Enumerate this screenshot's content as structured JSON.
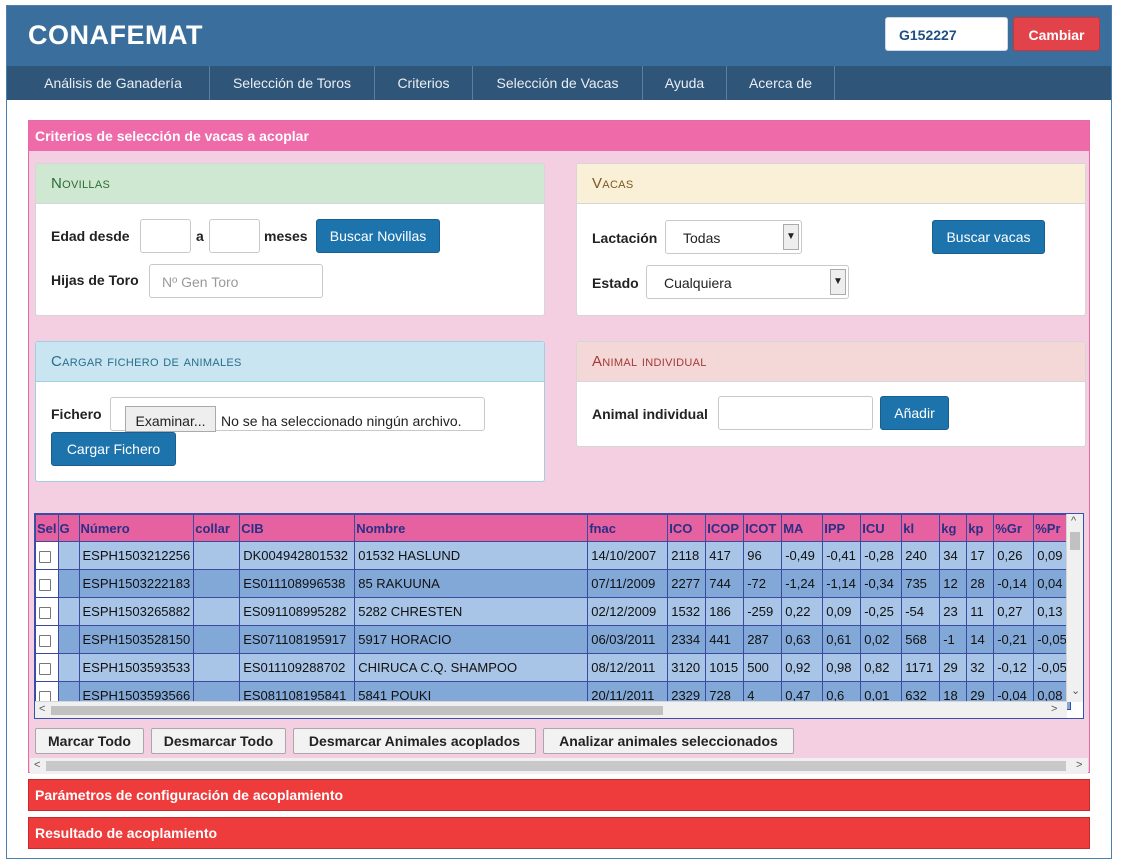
{
  "app": {
    "title": "CONAFEMAT",
    "user_code": "G152227",
    "change_label": "Cambiar"
  },
  "nav": [
    {
      "label": "Análisis de Ganadería"
    },
    {
      "label": "Selección de Toros"
    },
    {
      "label": "Criterios"
    },
    {
      "label": "Selección de Vacas"
    },
    {
      "label": "Ayuda"
    },
    {
      "label": "Acerca de"
    }
  ],
  "criteria_panel": {
    "title": "Criterios de selección de vacas a acoplar"
  },
  "novillas": {
    "title": "Novillas",
    "age_from_label": "Edad desde",
    "age_from_value": "",
    "to_label": "a",
    "age_to_value": "",
    "months_label": "meses",
    "search_button": "Buscar Novillas",
    "daughters_label": "Hijas de Toro",
    "bull_placeholder": "Nº Gen Toro"
  },
  "vacas": {
    "title": "Vacas",
    "lactation_label": "Lactación",
    "lactation_value": "Todas",
    "state_label": "Estado",
    "state_value": "Cualquiera",
    "search_button": "Buscar vacas"
  },
  "file_upload": {
    "title": "Cargar fichero de animales",
    "file_label": "Fichero",
    "browse_button": "Examinar...",
    "no_file_text": "No se ha seleccionado ningún archivo.",
    "upload_button": "Cargar Fichero"
  },
  "individual": {
    "title": "Animal individual",
    "field_label": "Animal individual",
    "field_value": "",
    "add_button": "Añadir"
  },
  "animals_table": {
    "columns": [
      "Sel",
      "G",
      "Número",
      "collar",
      "CIB",
      "Nombre",
      "fnac",
      "ICO",
      "ICOP",
      "ICOT",
      "MA",
      "IPP",
      "ICU",
      "kl",
      "kg",
      "kp",
      "%Gr",
      "%Pr"
    ],
    "rows": [
      {
        "numero": "ESPH1503212256",
        "collar": "",
        "cib": "DK004942801532",
        "nombre": "01532 HASLUND",
        "fnac": "14/10/2007",
        "ico": "2118",
        "icop": "417",
        "icot": "96",
        "ma": "-0,49",
        "ipp": "-0,41",
        "icu": "-0,28",
        "kl": "240",
        "kg": "34",
        "kp": "17",
        "gr": "0,26",
        "pr": "0,09"
      },
      {
        "numero": "ESPH1503222183",
        "collar": "",
        "cib": "ES011108996538",
        "nombre": "85 RAKUUNA",
        "fnac": "07/11/2009",
        "ico": "2277",
        "icop": "744",
        "icot": "-72",
        "ma": "-1,24",
        "ipp": "-1,14",
        "icu": "-0,34",
        "kl": "735",
        "kg": "12",
        "kp": "28",
        "gr": "-0,14",
        "pr": "0,04"
      },
      {
        "numero": "ESPH1503265882",
        "collar": "",
        "cib": "ES091108995282",
        "nombre": "5282 CHRESTEN",
        "fnac": "02/12/2009",
        "ico": "1532",
        "icop": "186",
        "icot": "-259",
        "ma": "0,22",
        "ipp": "0,09",
        "icu": "-0,25",
        "kl": "-54",
        "kg": "23",
        "kp": "11",
        "gr": "0,27",
        "pr": "0,13"
      },
      {
        "numero": "ESPH1503528150",
        "collar": "",
        "cib": "ES071108195917",
        "nombre": "5917 HORACIO",
        "fnac": "06/03/2011",
        "ico": "2334",
        "icop": "441",
        "icot": "287",
        "ma": "0,63",
        "ipp": "0,61",
        "icu": "0,02",
        "kl": "568",
        "kg": "-1",
        "kp": "14",
        "gr": "-0,21",
        "pr": "-0,05"
      },
      {
        "numero": "ESPH1503593533",
        "collar": "",
        "cib": "ES011109288702",
        "nombre": "CHIRUCA C.Q. SHAMPOO",
        "fnac": "08/12/2011",
        "ico": "3120",
        "icop": "1015",
        "icot": "500",
        "ma": "0,92",
        "ipp": "0,98",
        "icu": "0,82",
        "kl": "1171",
        "kg": "29",
        "kp": "32",
        "gr": "-0,12",
        "pr": "-0,05"
      },
      {
        "numero": "ESPH1503593566",
        "collar": "",
        "cib": "ES081108195841",
        "nombre": "5841 POUKI",
        "fnac": "20/11/2011",
        "ico": "2329",
        "icop": "728",
        "icot": "4",
        "ma": "0,47",
        "ipp": "0,6",
        "icu": "0,01",
        "kl": "632",
        "kg": "18",
        "kp": "29",
        "gr": "-0,04",
        "pr": "0,08"
      }
    ]
  },
  "actions": {
    "mark_all": "Marcar Todo",
    "unmark_all": "Desmarcar Todo",
    "unmark_coupled": "Desmarcar Animales acoplados",
    "analyze_selected": "Analizar animales seleccionados"
  },
  "sections": {
    "config_params": "Parámetros de configuración de acoplamiento",
    "coupling_result": "Resultado de acoplamiento"
  },
  "colors": {
    "header": "#3a6e9c",
    "navbar": "#2f5679",
    "pink_panel": "#ee6aa8",
    "red_section": "#ee3b3b",
    "primary_button": "#1d74ad"
  }
}
